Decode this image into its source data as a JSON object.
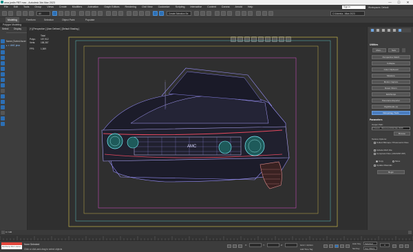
{
  "window": {
    "title": "ama jordin FBT max - Autodesk 3ds Max 2023",
    "minimize": "—",
    "maximize": "☐",
    "close": "✕"
  },
  "menu": {
    "items": [
      "File",
      "Edit",
      "Tools",
      "Group",
      "Views",
      "Create",
      "Modifiers",
      "Animation",
      "Graph Editors",
      "Rendering",
      "Civil View",
      "Customize",
      "Scripting",
      "Interactive",
      "Content",
      "Corona",
      "Arnold",
      "Help"
    ],
    "signin": "Sign In",
    "workspaces": "Workspaces: Default"
  },
  "toolbar": {
    "selection_filter": "All",
    "named_selection": "Create Selection Se",
    "project": "C:\\Users\\a...\\Max 2023"
  },
  "ribbon": {
    "tabs": [
      "Modeling",
      "Freeform",
      "Selection",
      "Object Paint",
      "Populate"
    ],
    "sub": "Polygon Modeling"
  },
  "left_panel": {
    "tabs": [
      "Select",
      "Display"
    ],
    "rows": [
      "Name (Sorted Ascer",
      "▸ ⚬ AMC java"
    ]
  },
  "viewport": {
    "label": "[+] [Perspective ] [User Defined ] [Default Shading ]",
    "stats_header": "Total",
    "polys_label": "Polys:",
    "polys": "157,912",
    "verts_label": "Verts:",
    "verts": "158,387",
    "fps_label": "FPS:",
    "fps": "1,369",
    "car_badge": "AMC"
  },
  "right_panel": {
    "utilities_header": "Utilities",
    "top_buttons": [
      "More...",
      "Sets"
    ],
    "buttons": [
      "Perspective Match",
      "Collapse",
      "Color Clipboard",
      "Measure",
      "Motion Capture",
      "Reset XForm",
      "MAXScript",
      "Panorama Exporter",
      "FlightStudio (c)",
      "Retopology Tools"
    ],
    "active_button": "Retopology Tools",
    "params_header": "Parameters",
    "output_path_label": "Output Path:",
    "output_path": "C:\\Users\\...\\Documents\\3ds Max 2023\\",
    "browse": "Browse",
    "options_header": "Texture Options:",
    "opt1": "Collect Bitmaps / Photometric Files",
    "opt2": "Include MAX File",
    "opt3": "Compress Files (.MAXZIP/.ZIP)",
    "radio_copy": "Copy",
    "radio_move": "Move",
    "opt4": "Update Materials",
    "begin": "Begin"
  },
  "timeline": {
    "frame": "0 / 100"
  },
  "status": {
    "maxscript": "MAXScript Mini Listener",
    "line1": "None Selected",
    "line2": "Click or click-and-drag to select objects",
    "x_label": "X:",
    "y_label": "Y:",
    "z_label": "Z:",
    "grid": "Grid = 10,0cm",
    "add_time_tag": "Add Time Tag",
    "autokey": "Auto Key",
    "selected": "Selected",
    "setkey": "Set Key",
    "keyfilters": "Key Filters...",
    "frame_box": "0"
  }
}
